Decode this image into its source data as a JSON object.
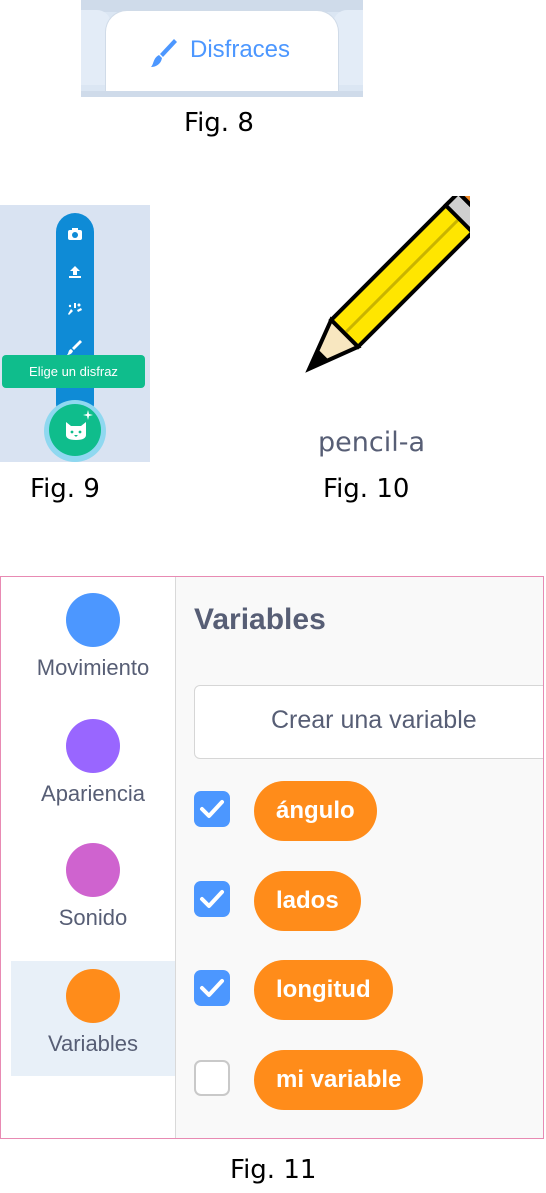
{
  "fig8": {
    "caption": "Fig. 8",
    "tab_label": "Disfraces",
    "tab_icon": "brush-icon",
    "colors": {
      "tab_text": "#4c97ff",
      "background": "#dbe6f3"
    }
  },
  "fig9": {
    "caption": "Fig. 9",
    "menu_icons": [
      "camera-icon",
      "upload-icon",
      "surprise-icon",
      "paint-icon"
    ],
    "tooltip": "Elige un disfraz",
    "fab_icon": "cat-face-icon",
    "colors": {
      "menu": "#0f8bd6",
      "tooltip": "#0fbd8c",
      "fab": "#0fbd8c"
    }
  },
  "fig10": {
    "caption": "Fig. 10",
    "costume_name": "pencil-a",
    "image": "pencil-icon"
  },
  "fig11": {
    "caption": "Fig. 11",
    "categories": [
      {
        "label": "Movimiento",
        "color": "#4c97ff",
        "selected": false
      },
      {
        "label": "Apariencia",
        "color": "#9966ff",
        "selected": false
      },
      {
        "label": "Sonido",
        "color": "#cf63cf",
        "selected": false
      },
      {
        "label": "Variables",
        "color": "#ff8c1a",
        "selected": true
      }
    ],
    "palette_title": "Variables",
    "make_variable_button": "Crear una variable",
    "variables": [
      {
        "name": "ángulo",
        "checked": true
      },
      {
        "name": "lados",
        "checked": true
      },
      {
        "name": "longitud",
        "checked": true
      },
      {
        "name": "mi variable",
        "checked": false
      }
    ],
    "colors": {
      "variable_block": "#ff8c1a",
      "checkbox": "#4c97ff",
      "frame_border": "#e88ab3"
    }
  }
}
